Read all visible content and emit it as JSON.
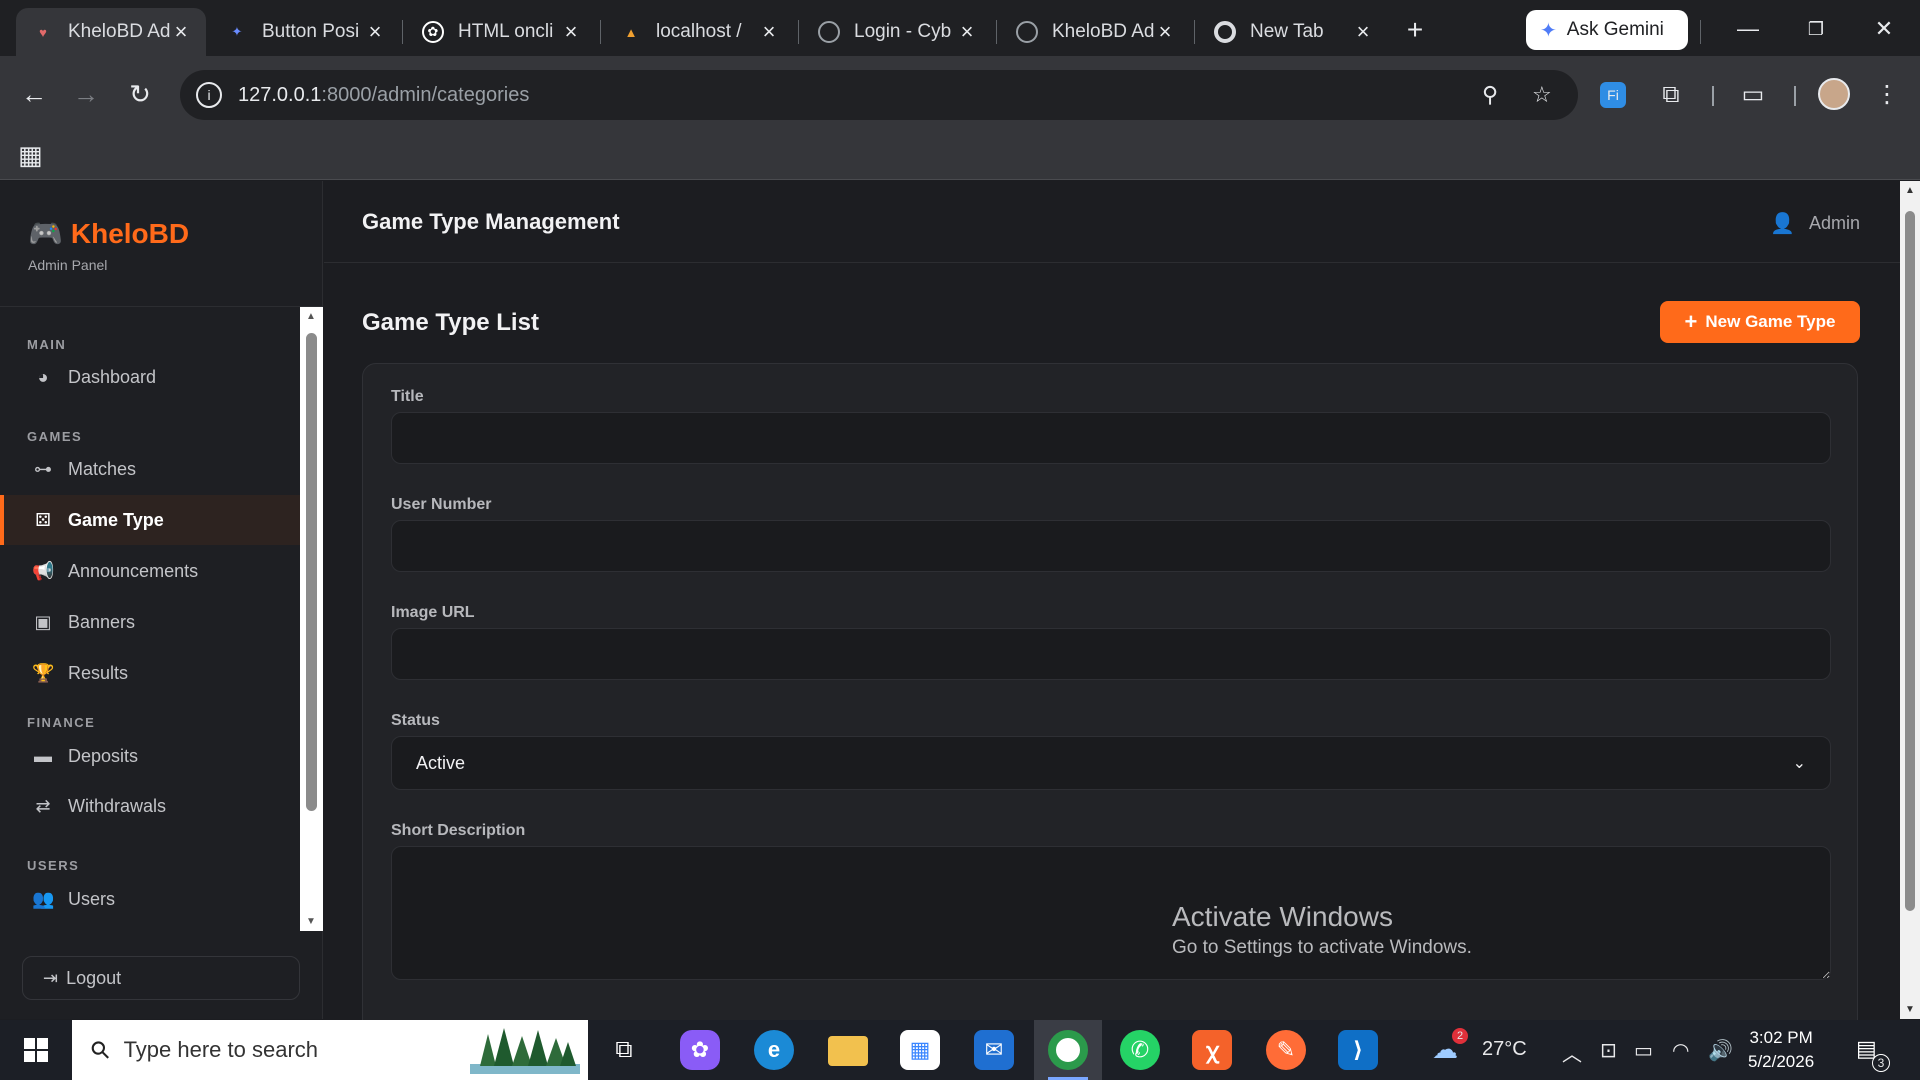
{
  "browser": {
    "tabs": [
      {
        "title": "KheloBD Ad",
        "favicon": "kite-heart-icon",
        "color": "#e26a6a"
      },
      {
        "title": "Button Posi",
        "favicon": "gemini-star-icon",
        "color": "#6a8cff"
      },
      {
        "title": "HTML oncli",
        "favicon": "openai-icon",
        "color": "#ffffff"
      },
      {
        "title": "localhost /",
        "favicon": "phpmyadmin-icon",
        "color": "#f0a030"
      },
      {
        "title": "Login - Cyb",
        "favicon": "globe-icon",
        "color": "#9aa0a6"
      },
      {
        "title": "KheloBD Ad",
        "favicon": "globe-icon",
        "color": "#9aa0a6"
      },
      {
        "title": "New Tab",
        "favicon": "chrome-icon",
        "color": "#dadce0"
      }
    ],
    "new_tab": "+",
    "ask_gemini": "Ask Gemini",
    "url_host": "127.0.0.1",
    "url_path": ":8000/admin/categories"
  },
  "sidebar": {
    "brand": "KheloBD",
    "brand_sub": "Admin Panel",
    "sections": {
      "main": "MAIN",
      "games": "GAMES",
      "finance": "FINANCE",
      "users": "USERS"
    },
    "items": {
      "dashboard": "Dashboard",
      "matches": "Matches",
      "game_type": "Game Type",
      "announcements": "Announcements",
      "banners": "Banners",
      "results": "Results",
      "deposits": "Deposits",
      "withdrawals": "Withdrawals",
      "users": "Users"
    },
    "logout": "Logout"
  },
  "header": {
    "title": "Game Type Management",
    "user": "Admin"
  },
  "main": {
    "list_title": "Game Type List",
    "new_button": "New Game Type",
    "form": {
      "title_label": "Title",
      "title_value": "",
      "user_number_label": "User Number",
      "user_number_value": "",
      "image_url_label": "Image URL",
      "image_url_value": "",
      "status_label": "Status",
      "status_value": "Active",
      "short_desc_label": "Short Description",
      "short_desc_value": ""
    }
  },
  "watermark": {
    "line1": "Activate Windows",
    "line2": "Go to Settings to activate Windows."
  },
  "taskbar": {
    "search_placeholder": "Type here to search",
    "weather": "27°C",
    "weather_badge": "2",
    "time": "3:02 PM",
    "date": "5/2/2026",
    "notifications": "3"
  },
  "colors": {
    "accent": "#ff6a1a",
    "bg": "#1c1d21",
    "card": "#222327"
  }
}
